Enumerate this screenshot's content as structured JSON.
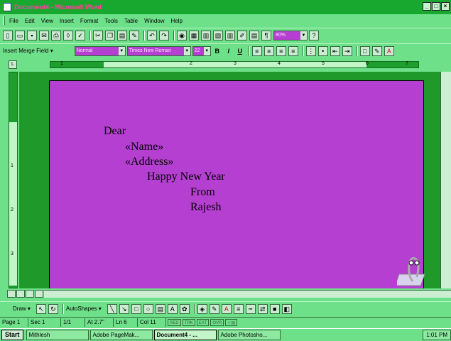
{
  "window": {
    "title": "Document4 - Microsoft Word",
    "controls": [
      "_",
      "□",
      "×"
    ]
  },
  "menu": {
    "items": [
      "File",
      "Edit",
      "View",
      "Insert",
      "Format",
      "Tools",
      "Table",
      "Window",
      "Help"
    ]
  },
  "standard_toolbar": {
    "zoom": "80%"
  },
  "formatting_toolbar": {
    "merge_field_label": "Insert Merge Field ▾",
    "style": "Normal",
    "font": "Times New Roman",
    "font_size": "22",
    "bold": "B",
    "italic": "I",
    "underline": "U"
  },
  "ruler": {
    "h_numbers": [
      "1",
      "2",
      "3",
      "4",
      "5",
      "6",
      "7"
    ],
    "v_numbers": [
      "1",
      "2",
      "3"
    ]
  },
  "document": {
    "lines": [
      "Dear",
      "«Name»",
      "«Address»",
      "Happy New Year",
      "From",
      "Rajesh"
    ]
  },
  "drawing_toolbar": {
    "draw_label": "Draw ▾",
    "autoshapes_label": "AutoShapes ▾"
  },
  "status": {
    "page": "Page 1",
    "sec": "Sec 1",
    "pages": "1/1",
    "at": "At 2.7\"",
    "ln": "Ln 6",
    "col": "Col 11",
    "indicators": [
      "REC",
      "TRK",
      "EXT",
      "OVR"
    ]
  },
  "taskbar": {
    "start_label": "Start",
    "tasks": [
      "Mithlesh",
      "Adobe PageMak...",
      "Document4 - ...",
      "Adobe Photosho..."
    ],
    "clock": "1:01 PM"
  },
  "colors": {
    "chrome": "#6fe08a",
    "titlebar": "#19a82f",
    "title_text": "#ff3fa4",
    "page": "#b43fd0",
    "workspace": "#1f9a2a"
  }
}
